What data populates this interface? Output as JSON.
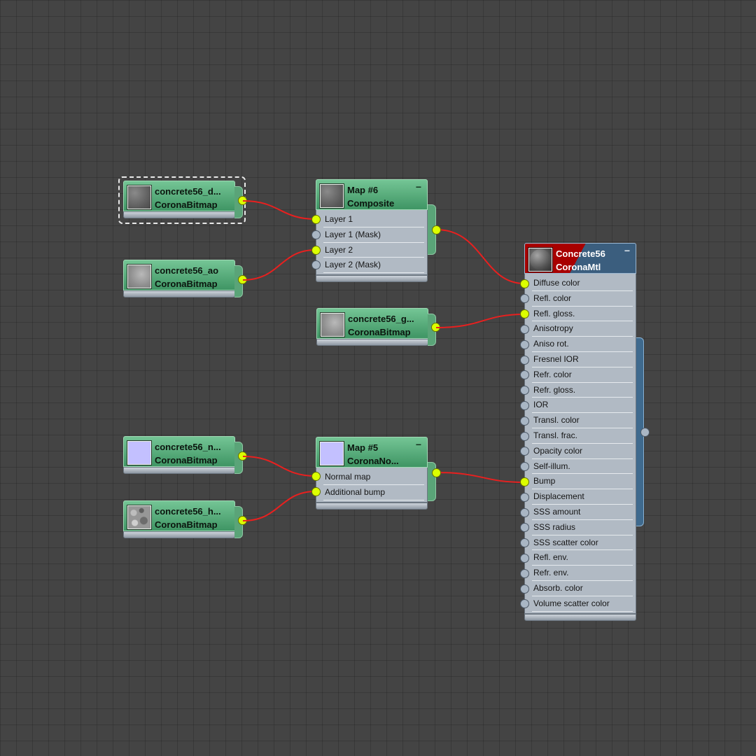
{
  "colors": {
    "canvas": "#444444",
    "wire": "#e8201f",
    "socket_connected": "#dcff00",
    "socket_empty": "#a9b6c4",
    "map_node": "#5aa478",
    "material_accent": "#a80000",
    "material_blue": "#3b5e7e"
  },
  "bitmap_nodes": [
    {
      "name": "concrete56_d...",
      "type": "CoronaBitmap",
      "thumb": "dark-concrete-thumbnail",
      "selected": true
    },
    {
      "name": "concrete56_ao",
      "type": "CoronaBitmap",
      "thumb": "light-concrete-thumbnail"
    },
    {
      "name": "concrete56_g...",
      "type": "CoronaBitmap",
      "thumb": "light-concrete-thumbnail"
    },
    {
      "name": "concrete56_n...",
      "type": "CoronaBitmap",
      "thumb": "normal-map-thumbnail"
    },
    {
      "name": "concrete56_h...",
      "type": "CoronaBitmap",
      "thumb": "height-map-thumbnail"
    }
  ],
  "composite_node": {
    "name": "Map #6",
    "type": "Composite",
    "collapse": "−",
    "slots": [
      "Layer 1",
      "Layer 1 (Mask)",
      "Layer 2",
      "Layer 2 (Mask)"
    ]
  },
  "normal_node": {
    "name": "Map #5",
    "type": "CoronaNo...",
    "collapse": "−",
    "slots": [
      "Normal map",
      "Additional bump"
    ]
  },
  "material_node": {
    "name": "Concrete56",
    "type": "CoronaMtl",
    "collapse": "−",
    "slots": [
      "Diffuse color",
      "Refl. color",
      "Refl. gloss.",
      "Anisotropy",
      "Aniso rot.",
      "Fresnel IOR",
      "Refr. color",
      "Refr. gloss.",
      "IOR",
      "Transl. color",
      "Transl. frac.",
      "Opacity color",
      "Self-illum.",
      "Bump",
      "Displacement",
      "SSS amount",
      "SSS radius",
      "SSS scatter color",
      "Refl. env.",
      "Refr. env.",
      "Absorb. color",
      "Volume scatter color"
    ]
  }
}
